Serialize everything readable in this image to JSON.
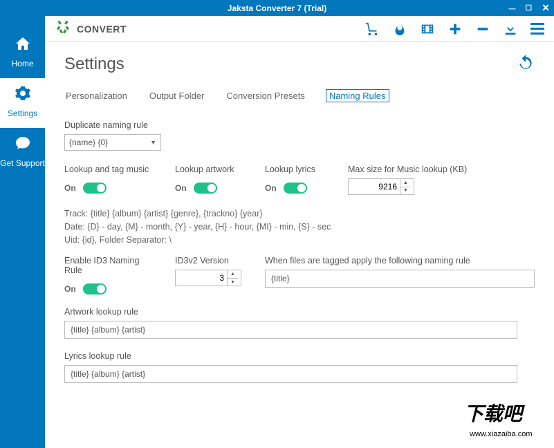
{
  "window": {
    "title": "Jaksta Converter 7 (Trial)"
  },
  "sidebar": {
    "items": [
      {
        "label": "Home"
      },
      {
        "label": "Settings"
      },
      {
        "label": "Get Support"
      }
    ]
  },
  "toolbar": {
    "convert_label": "CONVERT"
  },
  "page": {
    "title": "Settings"
  },
  "tabs": {
    "personalization": "Personalization",
    "output_folder": "Output Folder",
    "conversion_presets": "Conversion Presets",
    "naming_rules": "Naming Rules"
  },
  "form": {
    "duplicate_label": "Duplicate naming rule",
    "duplicate_value": "{name} {0}",
    "lookup_tag_label": "Lookup and tag music",
    "lookup_artwork_label": "Lookup artwork",
    "lookup_lyrics_label": "Lookup lyrics",
    "max_size_label": "Max size for Music lookup (KB)",
    "max_size_value": "9216",
    "on": "On",
    "help1": "Track: {title} {album} {artist} {genre}, {trackno} {year}",
    "help2": "Date: {D} - day, {M} - month, {Y} - year, {H} - hour, {MI} - min, {S} - sec",
    "help3": "Uid: {id}, Folder Separator: \\",
    "enable_id3_label": "Enable ID3 Naming Rule",
    "id3v2_label": "ID3v2 Version",
    "id3v2_value": "3",
    "tagged_rule_label": "When files are tagged apply the following naming rule",
    "tagged_rule_value": "{title}",
    "artwork_rule_label": "Artwork lookup rule",
    "artwork_rule_value": "{title} {album} {artist}",
    "lyrics_rule_label": "Lyrics lookup rule",
    "lyrics_rule_value": "{title} {album} {artist}"
  },
  "watermark": {
    "url": "www.xiazaiba.com"
  }
}
